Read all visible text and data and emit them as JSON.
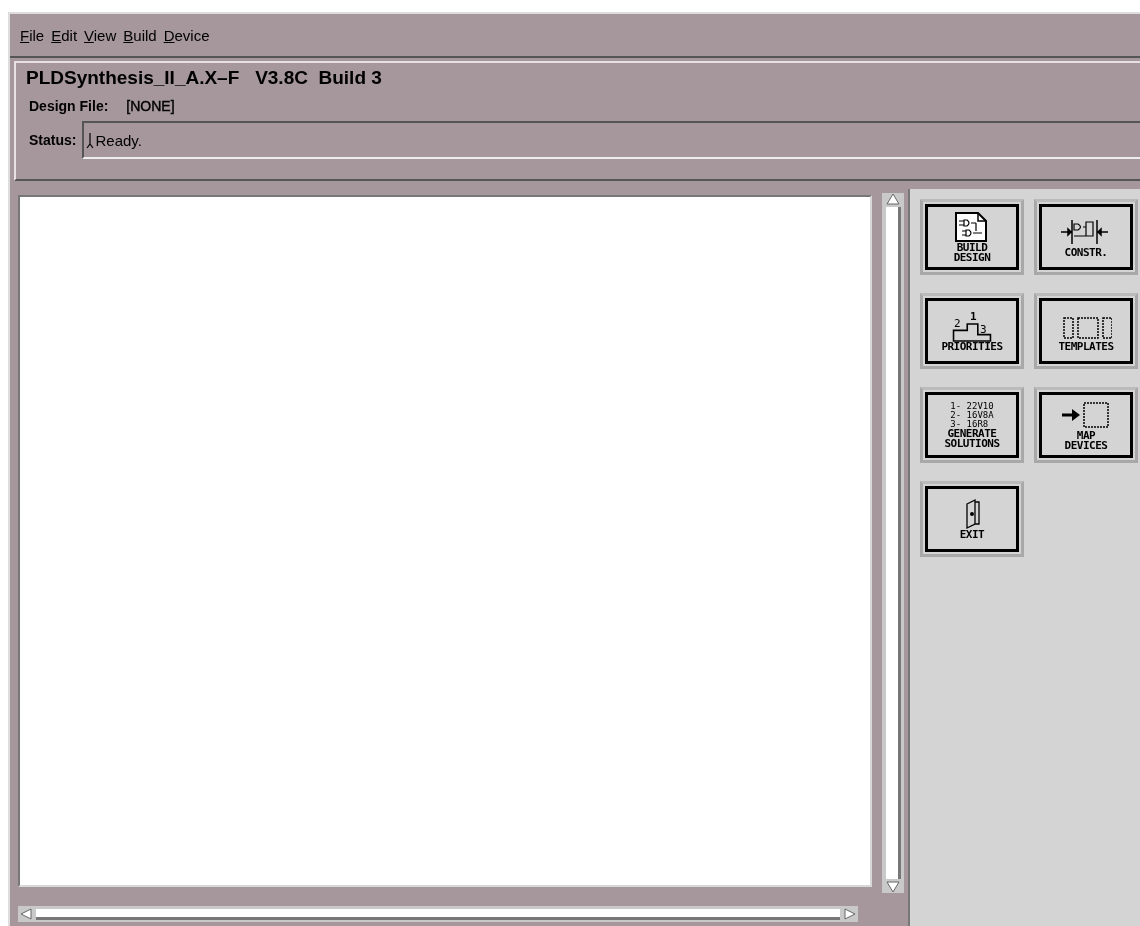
{
  "menu": [
    {
      "label": "File"
    },
    {
      "label": "Edit"
    },
    {
      "label": "View"
    },
    {
      "label": "Build"
    },
    {
      "label": "Device"
    }
  ],
  "header": {
    "title": "PLDSynthesis_II_A.X–F   V3.8C  Build 3",
    "design_file_label": "Design File:",
    "design_file_value": "[NONE]",
    "status_label": "Status:",
    "status_value": "Ready."
  },
  "tools": [
    {
      "kind": "build",
      "label": "BUILD\nDESIGN"
    },
    {
      "kind": "constraints",
      "label": "CONSTR."
    },
    {
      "kind": "priorities",
      "label": "PRIORITIES",
      "icon_texts": [
        "2",
        "1",
        "3"
      ]
    },
    {
      "kind": "templates",
      "label": "TEMPLATES"
    },
    {
      "kind": "generate",
      "label": "GENERATE\nSOLUTIONS",
      "icon_texts": [
        "1- 22V10",
        "2- 16V8A",
        "3- 16R8"
      ]
    },
    {
      "kind": "map",
      "label": "MAP\nDEVICES"
    },
    {
      "kind": "exit",
      "label": "EXIT"
    }
  ]
}
